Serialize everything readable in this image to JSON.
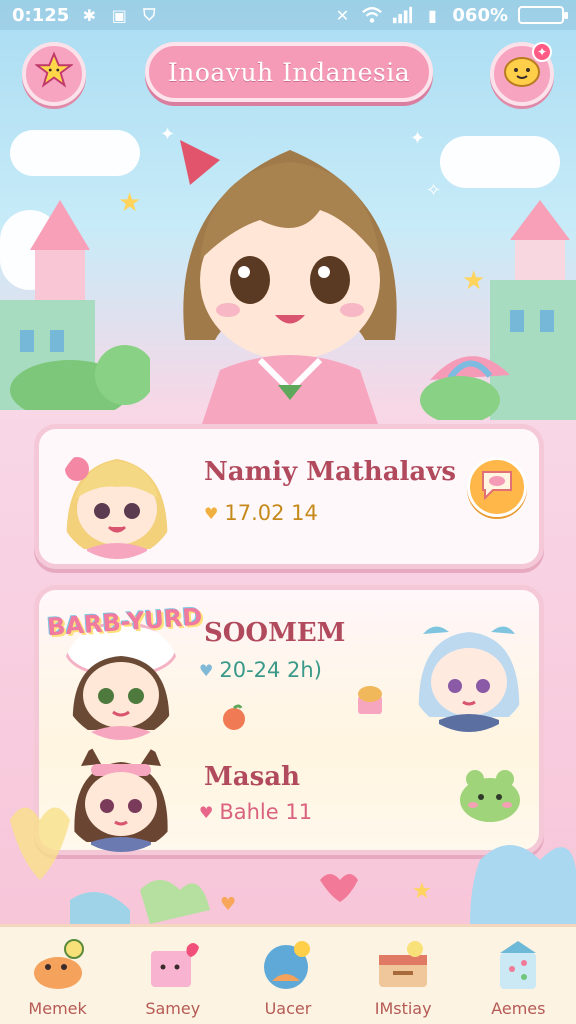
{
  "status_bar": {
    "time": "0:125",
    "battery_text": "060%"
  },
  "header": {
    "title": "Inoavuh Indanesia",
    "left_button_icon": "star-icon",
    "right_button_icon": "smiley-icon"
  },
  "cards": [
    {
      "name": "Namiy Mathalavs",
      "meta": "17.02 14",
      "meta_color": "#c58a1b",
      "heart_color": "#f0b040",
      "action_icon": "chat-bubble-icon"
    },
    {
      "badge_text": "BARB-YURD",
      "name": "SOOMEM",
      "meta": "20-24 2h)",
      "meta_color": "#3a9a8a",
      "heart_color": "#7fb9d6"
    },
    {
      "name": "Masah",
      "meta": "Bahle 11",
      "meta_color": "#d9637f",
      "heart_color": "#e8668a"
    }
  ],
  "bottom_nav": [
    {
      "label": "Memek",
      "icon": "food-icon"
    },
    {
      "label": "Samey",
      "icon": "gift-icon"
    },
    {
      "label": "Uacer",
      "icon": "ball-icon"
    },
    {
      "label": "IMstiay",
      "icon": "box-icon"
    },
    {
      "label": "Aemes",
      "icon": "milk-icon"
    }
  ],
  "colors": {
    "accent_pink": "#f59bb8",
    "name_red": "#b14a5d",
    "nav_label": "#b55a55"
  }
}
